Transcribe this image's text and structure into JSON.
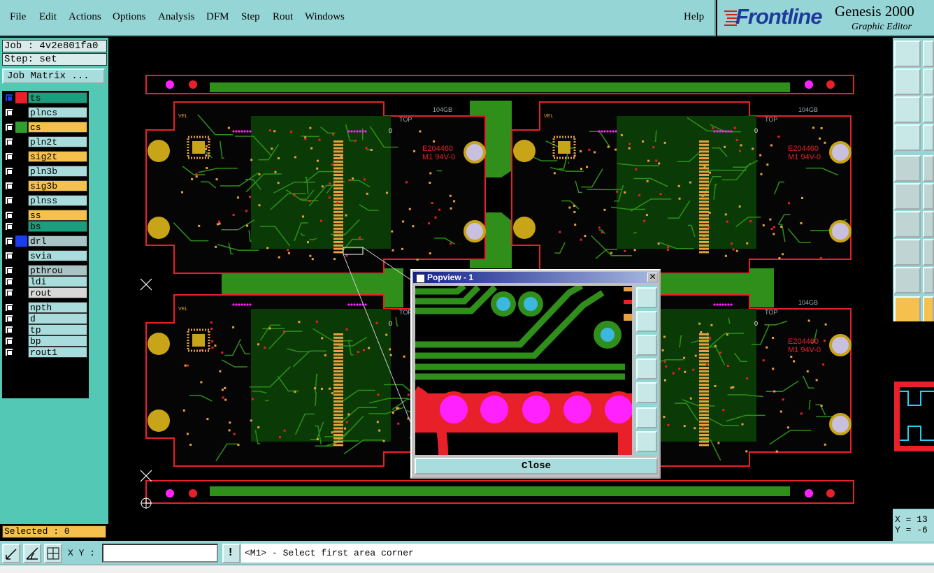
{
  "menu": {
    "items": [
      {
        "label": "File"
      },
      {
        "label": "Edit"
      },
      {
        "label": "Actions"
      },
      {
        "label": "Options"
      },
      {
        "label": "Analysis"
      },
      {
        "label": "DFM"
      },
      {
        "label": "Step"
      },
      {
        "label": "Rout"
      },
      {
        "label": "Windows"
      }
    ],
    "help": "Help"
  },
  "brand": {
    "logo": "Frontline",
    "product": "Genesis 2000",
    "subtitle": "Graphic Editor"
  },
  "job": {
    "job_line": "Job : 4v2e801fa0",
    "step_line": "Step: set",
    "matrix_button": "Job Matrix ..."
  },
  "layers": [
    {
      "name": "ts",
      "color": "#1a9e7d",
      "swatch": "#e8202a",
      "active": true
    },
    {
      "name": "plncs",
      "color": "#a9dcdd",
      "swatch": "#000000"
    },
    {
      "name": "cs",
      "color": "#f5c04c",
      "swatch": "#2f9e2f"
    },
    {
      "name": "pln2t",
      "color": "#a9dcdd",
      "swatch": "#000000"
    },
    {
      "name": "sig2t",
      "color": "#f5c04c",
      "swatch": "#000000"
    },
    {
      "name": "pln3b",
      "color": "#a9dcdd",
      "swatch": "#000000"
    },
    {
      "name": "sig3b",
      "color": "#f5c04c",
      "swatch": "#000000"
    },
    {
      "name": "plnss",
      "color": "#a9dcdd",
      "swatch": "#000000"
    },
    {
      "name": "ss",
      "color": "#f5c04c",
      "swatch": "#000000"
    },
    {
      "name": "bs",
      "color": "#1a9e7d",
      "swatch": "#000000"
    },
    {
      "name": "drl",
      "color": "#a9c4c4",
      "swatch": "#1a3cf0"
    },
    {
      "name": "svia",
      "color": "#a9dcdd",
      "swatch": "#000000"
    },
    {
      "name": "pthrou",
      "color": "#a9c4c4",
      "swatch": "#000000"
    },
    {
      "name": "ldi",
      "color": "#a9dcdd",
      "swatch": "#000000"
    },
    {
      "name": "rout",
      "color": "#d8d8d8",
      "swatch": "#000000"
    },
    {
      "name": "npth",
      "color": "#a9dcdd",
      "swatch": "#000000"
    },
    {
      "name": "d",
      "color": "#a9dcdd",
      "swatch": "#000000"
    },
    {
      "name": "tp",
      "color": "#a9dcdd",
      "swatch": "#000000"
    },
    {
      "name": "bp",
      "color": "#a9dcdd",
      "swatch": "#000000"
    },
    {
      "name": "rout1",
      "color": "#a9dcdd",
      "swatch": "#000000"
    }
  ],
  "selected": "Selected : 0",
  "board_labels": {
    "part_no": "E204460",
    "rating": "M1 94V-0",
    "code": "104GB",
    "top": "TOP",
    "zero": "0",
    "vel": "VEL"
  },
  "popview": {
    "title": "Popview - 1",
    "close_x": "✕",
    "close_button": "Close"
  },
  "coords": {
    "x": "X = 13",
    "y": "Y = -6"
  },
  "bottom": {
    "xy_label": "X Y :",
    "xy_value": "",
    "warn_icon": "!",
    "status": "<M1> - Select first area corner"
  },
  "colors": {
    "copper": "#2f8f1a",
    "outline": "#e8202a",
    "pad": "#e8a040",
    "via": "#ff22ff",
    "hole": "#c7a418"
  }
}
